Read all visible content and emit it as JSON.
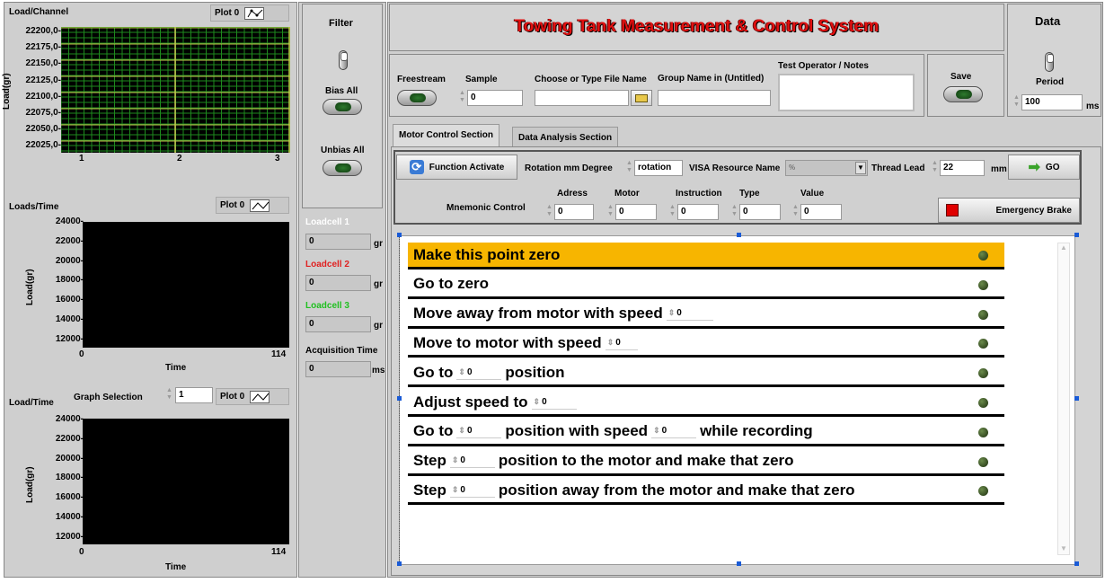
{
  "charts": {
    "load_channel": {
      "title": "Load/Channel",
      "plot_label": "Plot 0",
      "ylabel": "Load(gr)",
      "yticks": [
        "22200,0-",
        "22175,0-",
        "22150,0-",
        "22125,0-",
        "22100,0-",
        "22075,0-",
        "22050,0-",
        "22025,0-"
      ],
      "xticks": [
        "1",
        "2",
        "3"
      ]
    },
    "loads_time": {
      "title": "Loads/Time",
      "plot_label": "Plot 0",
      "ylabel": "Load(gr)",
      "xlabel": "Time",
      "yticks": [
        "24000-",
        "22000-",
        "20000-",
        "18000-",
        "16000-",
        "14000-",
        "12000-"
      ],
      "xticks": [
        "0",
        "114"
      ]
    },
    "load_time": {
      "title": "Load/Time",
      "graph_selection_label": "Graph Selection",
      "graph_selection_value": "1",
      "plot_label": "Plot 0",
      "ylabel": "Load(gr)",
      "xlabel": "Time",
      "yticks": [
        "24000-",
        "22000-",
        "20000-",
        "18000-",
        "16000-",
        "14000-",
        "12000-"
      ],
      "xticks": [
        "0",
        "114"
      ]
    }
  },
  "filter": {
    "title": "Filter",
    "bias_all": "Bias All",
    "unbias_all": "Unbias All"
  },
  "loadcells": [
    {
      "label": "Loadcell 1",
      "value": "0",
      "unit": "gr",
      "color": "#ffffff"
    },
    {
      "label": "Loadcell 2",
      "value": "0",
      "unit": "gr",
      "color": "#e02020"
    },
    {
      "label": "Loadcell 3",
      "value": "0",
      "unit": "gr",
      "color": "#20c020"
    }
  ],
  "acquisition": {
    "label": "Acquisition Time",
    "value": "0",
    "unit": "ms"
  },
  "header": {
    "title": "Towing Tank Measurement & Control System"
  },
  "data_box": {
    "title": "Data",
    "period_label": "Period",
    "period_value": "100",
    "period_unit": "ms"
  },
  "file_bar": {
    "freestream": "Freestream",
    "sample": "Sample",
    "sample_value": "0",
    "file_name_label": "Choose or Type  File Name",
    "file_name_value": "",
    "group_name_label": "Group Name in (Untitled)",
    "group_name_value": "",
    "operator_label": "Test Operator / Notes",
    "operator_value": "",
    "save": "Save"
  },
  "tabs": [
    "Motor Control Section",
    "Data Analysis Section"
  ],
  "motor": {
    "function_activate": "Function Activate",
    "rotation_label": "Rotation mm Degree",
    "rotation_value": "rotation",
    "visa_label": "VISA Resource Name",
    "visa_value": "",
    "thread_lead_label": "Thread Lead",
    "thread_lead_value": "22",
    "thread_lead_unit": "mm",
    "go": "GO",
    "mnemonic": "Mnemonic Control",
    "adress_label": "Adress",
    "adress_value": "0",
    "motor_label": "Motor",
    "motor_value": "0",
    "instruction_label": "Instruction",
    "instruction_value": "0",
    "type_label": "Type",
    "type_value": "0",
    "value_label": "Value",
    "value_value": "0",
    "emergency": "Emergency Brake"
  },
  "commands": [
    {
      "parts": [
        "Make this point zero"
      ],
      "inputs": [],
      "highlight": true
    },
    {
      "parts": [
        "Go to zero"
      ],
      "inputs": []
    },
    {
      "parts": [
        "Move away from motor with speed",
        ""
      ],
      "inputs": [
        "0"
      ]
    },
    {
      "parts": [
        "Move to motor with speed",
        ""
      ],
      "inputs": [
        "0"
      ]
    },
    {
      "parts": [
        "Go to",
        "position"
      ],
      "inputs": [
        "0"
      ]
    },
    {
      "parts": [
        "Adjust speed to",
        ""
      ],
      "inputs": [
        "0"
      ]
    },
    {
      "parts": [
        "Go to",
        "position with speed",
        "while recording"
      ],
      "inputs": [
        "0",
        "0"
      ]
    },
    {
      "parts": [
        "Step",
        "position to the motor and make that zero"
      ],
      "inputs": [
        "0"
      ]
    },
    {
      "parts": [
        "Step",
        "position away from the motor and make that zero"
      ],
      "inputs": [
        "0"
      ]
    }
  ],
  "colors": {
    "title_red": "#e01010",
    "highlight": "#f7b500",
    "panel": "#d4d4d4"
  }
}
